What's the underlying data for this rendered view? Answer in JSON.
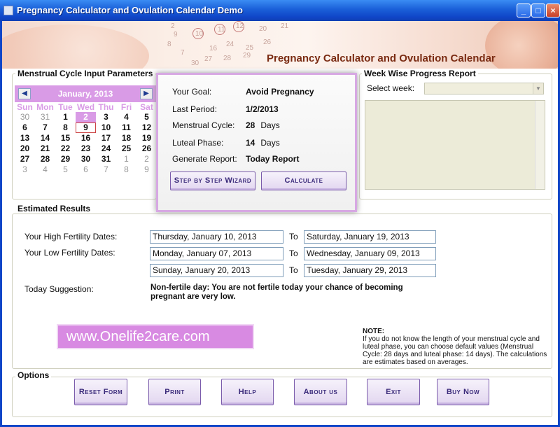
{
  "window": {
    "title": "Pregnancy Calculator and Ovulation Calendar Demo"
  },
  "banner": {
    "title": "Pregnancy Calculator and Ovulation Calendar",
    "numbers": [
      "2",
      "9",
      "10",
      "11",
      "12",
      "20",
      "21",
      "8",
      "7",
      "16",
      "24",
      "25",
      "26",
      "27",
      "28",
      "29",
      "30"
    ]
  },
  "menstrual_group": {
    "label": "Menstrual Cycle Input Parameters"
  },
  "calendar": {
    "month_label": "January, 2013",
    "weekdays": [
      "Sun",
      "Mon",
      "Tue",
      "Wed",
      "Thu",
      "Fri",
      "Sat"
    ],
    "weeks": [
      [
        "30",
        "31",
        "1",
        "2",
        "3",
        "4",
        "5"
      ],
      [
        "6",
        "7",
        "8",
        "9",
        "10",
        "11",
        "12"
      ],
      [
        "13",
        "14",
        "15",
        "16",
        "17",
        "18",
        "19"
      ],
      [
        "20",
        "21",
        "22",
        "23",
        "24",
        "25",
        "26"
      ],
      [
        "27",
        "28",
        "29",
        "30",
        "31",
        "1",
        "2"
      ],
      [
        "3",
        "4",
        "5",
        "6",
        "7",
        "8",
        "9"
      ]
    ],
    "selected": "2",
    "today": "9"
  },
  "panel": {
    "goal_label": "Your Goal:",
    "goal_value": "Avoid Pregnancy",
    "period_label": "Last Period:",
    "period_value": "1/2/2013",
    "cycle_label": "Menstrual Cycle:",
    "cycle_value": "28",
    "cycle_unit": "Days",
    "luteal_label": "Luteal Phase:",
    "luteal_value": "14",
    "luteal_unit": "Days",
    "report_label": "Generate Report:",
    "report_value": "Today Report",
    "wizard_button": "Step by Step Wizard",
    "calculate_button": "Calculate"
  },
  "week_report": {
    "label": "Week Wise Progress Report",
    "select_label": "Select week:",
    "select_value": ""
  },
  "results": {
    "label": "Estimated Results",
    "high_label": "Your High Fertility Dates:",
    "low_label": "Your Low Fertility Dates:",
    "to": "To",
    "high_from": "Thursday, January 10, 2013",
    "high_to": "Saturday, January 19, 2013",
    "low1_from": "Monday, January 07, 2013",
    "low1_to": "Wednesday, January 09, 2013",
    "low2_from": "Sunday, January 20, 2013",
    "low2_to": "Tuesday, January 29, 2013",
    "suggestion_label": "Today Suggestion:",
    "suggestion_text": "Non-fertile day: You are not fertile today your chance of becoming pregnant are very low.",
    "site": "www.Onelife2care.com",
    "note_title": "NOTE:",
    "note_text": "If you do not know the length of your menstrual cycle and luteal phase, you can choose default values (Menstrual Cycle: 28 days and luteal phase: 14 days). The calculations are estimates based on averages."
  },
  "options": {
    "label": "Options",
    "reset": "Reset Form",
    "print": "Print",
    "help": "Help",
    "about": "About us",
    "exit": "Exit",
    "buy": "Buy Now"
  },
  "colors": {
    "accent": "#d99be6",
    "titlebar": "#1a5fd8",
    "banner_title": "#7a2b12"
  }
}
